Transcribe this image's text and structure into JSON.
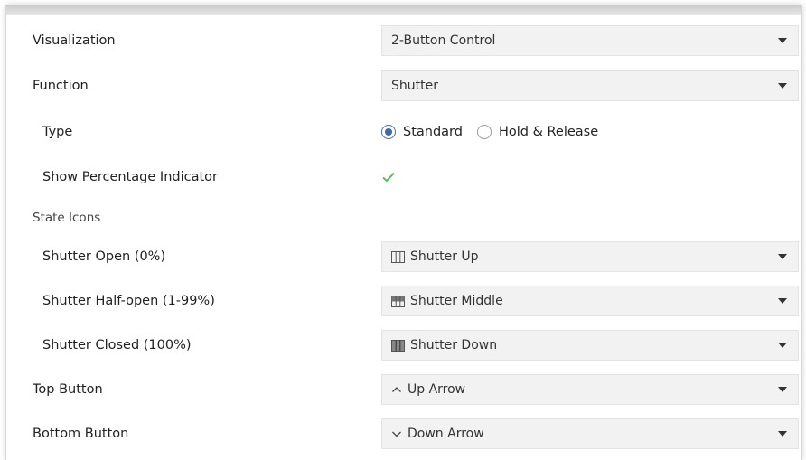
{
  "rows": {
    "visualization": {
      "label": "Visualization",
      "value": "2-Button Control"
    },
    "function": {
      "label": "Function",
      "value": "Shutter"
    },
    "type": {
      "label": "Type",
      "options": [
        "Standard",
        "Hold & Release"
      ],
      "selected": "Standard"
    },
    "percentage": {
      "label": "Show Percentage Indicator",
      "checked": true
    },
    "state_icons": {
      "label": "State Icons"
    },
    "shutter_open": {
      "label": "Shutter Open (0%)",
      "value": "Shutter Up",
      "icon": "shutter-up-icon"
    },
    "shutter_half": {
      "label": "Shutter Half-open (1-99%)",
      "value": "Shutter Middle",
      "icon": "shutter-middle-icon"
    },
    "shutter_closed": {
      "label": "Shutter Closed (100%)",
      "value": "Shutter Down",
      "icon": "shutter-down-icon"
    },
    "top_button": {
      "label": "Top Button",
      "value": "Up Arrow",
      "icon": "up-arrow-icon"
    },
    "bottom_button": {
      "label": "Bottom Button",
      "value": "Down Arrow",
      "icon": "down-arrow-icon"
    }
  },
  "colors": {
    "select_bg": "#f2f2f2",
    "radio_accent": "#3f6aa3",
    "check_green": "#5cb85c"
  }
}
